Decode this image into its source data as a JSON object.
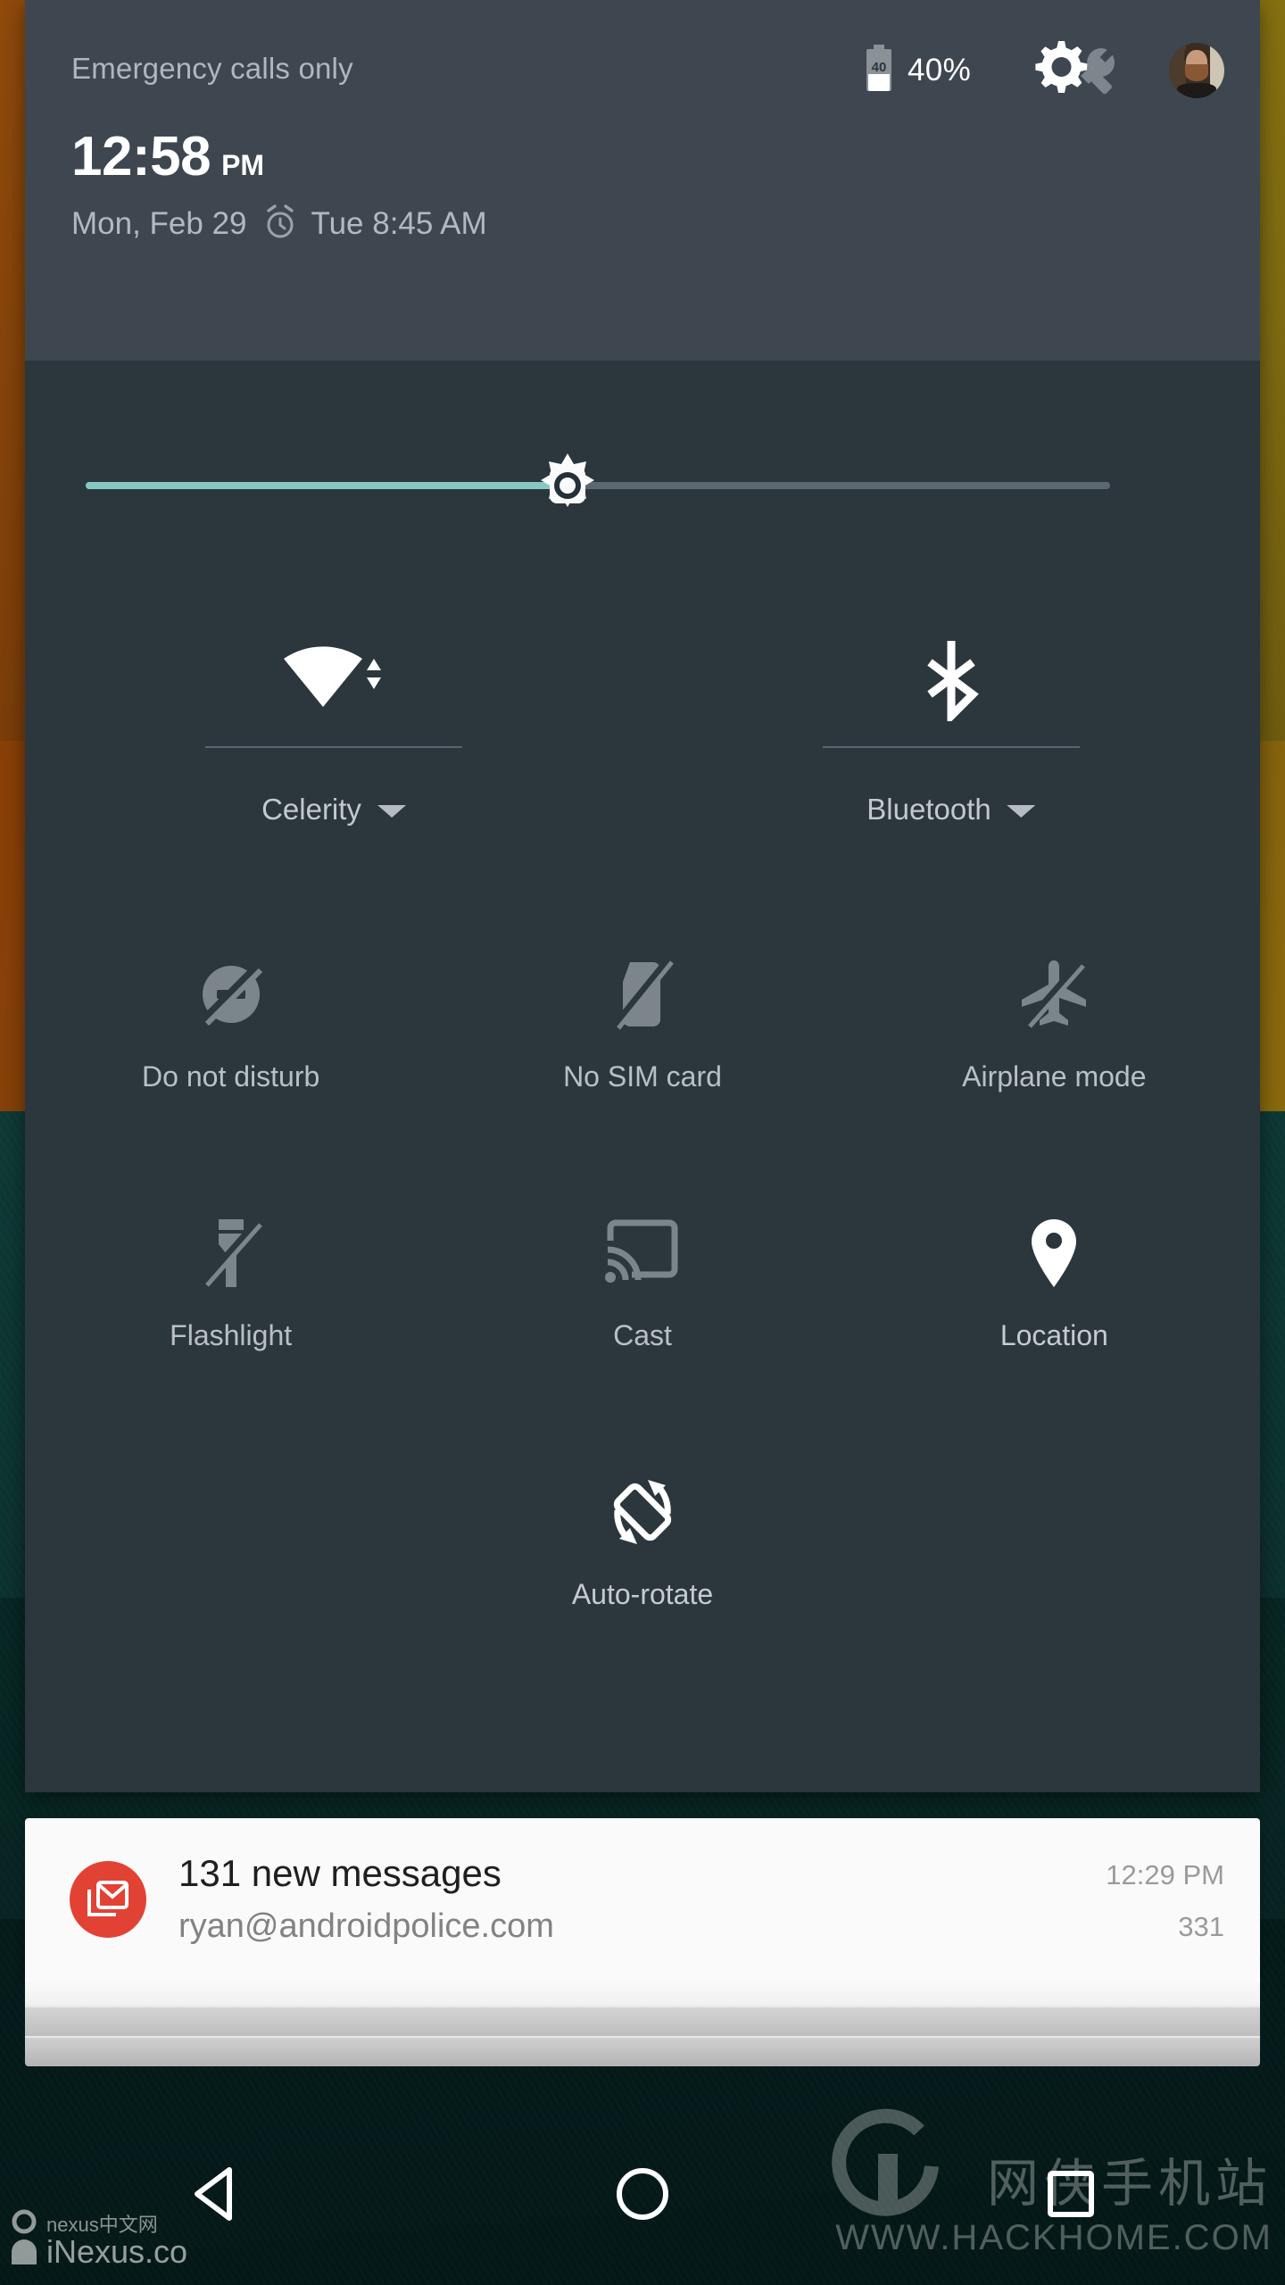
{
  "statusbar": {
    "carrier": "Emergency calls only",
    "battery_level": "40",
    "battery_percent": "40%",
    "battery_icon": "battery-40-icon",
    "settings_icon": "gear-icon",
    "wrench_icon": "wrench-icon",
    "avatar_icon": "user-avatar"
  },
  "clock": {
    "time": "12:58",
    "ampm": "PM",
    "date": "Mon, Feb 29",
    "alarm_icon": "alarm-clock-icon",
    "alarm_text": "Tue 8:45 AM"
  },
  "brightness": {
    "icon": "brightness-sun-icon",
    "value_percent": 47,
    "fill_color": "#86c9c4",
    "track_color": "#5c6870"
  },
  "big_tiles": [
    {
      "label": "Celerity",
      "icon": "wifi-icon",
      "state": "on",
      "has_caret": true
    },
    {
      "label": "Bluetooth",
      "icon": "bluetooth-icon",
      "state": "on",
      "has_caret": true
    }
  ],
  "tiles": [
    {
      "label": "Do not disturb",
      "icon": "do-not-disturb-icon",
      "state": "off"
    },
    {
      "label": "No SIM card",
      "icon": "sim-card-off-icon",
      "state": "off"
    },
    {
      "label": "Airplane mode",
      "icon": "airplane-off-icon",
      "state": "off"
    },
    {
      "label": "Flashlight",
      "icon": "flashlight-off-icon",
      "state": "off"
    },
    {
      "label": "Cast",
      "icon": "cast-icon",
      "state": "off"
    },
    {
      "label": "Location",
      "icon": "location-pin-icon",
      "state": "on"
    },
    {
      "label": "Auto-rotate",
      "icon": "auto-rotate-icon",
      "state": "on"
    }
  ],
  "notification": {
    "app_icon": "gmail-icon",
    "title": "131 new messages",
    "subtitle": "ryan@androidpolice.com",
    "time": "12:29 PM",
    "count": "331",
    "accent_color": "#e24234"
  },
  "navbar": {
    "back_icon": "back-triangle-icon",
    "home_icon": "home-circle-icon",
    "recents_icon": "recents-square-icon"
  },
  "watermarks": {
    "left_small": "nexus中文网",
    "left_main": "iNexus.co",
    "right_cn": "网侠手机站",
    "right_url": "WWW.HACKHOME.COM"
  },
  "colors": {
    "panel_bg": "#2c363d",
    "header_bg": "#3e4750",
    "icon_on": "#ffffff",
    "icon_off": "#7d858c",
    "label": "#c5cbd0"
  }
}
